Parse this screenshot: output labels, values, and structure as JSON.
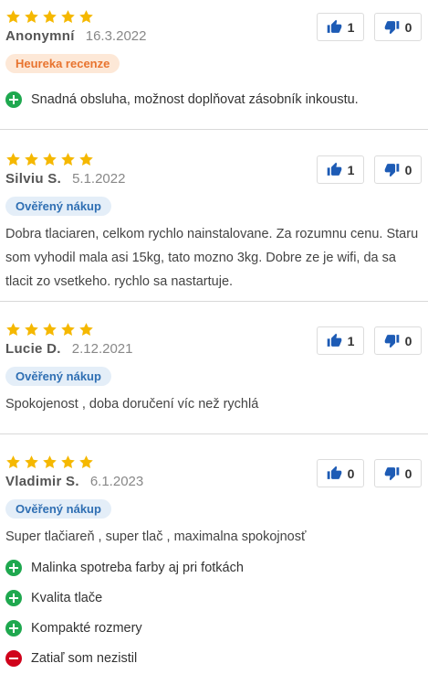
{
  "colors": {
    "star": "#f5b800",
    "accent": "#1d5bb5",
    "pro": "#1fa84f",
    "con": "#d0021b"
  },
  "reviews": [
    {
      "author": "Anonymní",
      "date": "16.3.2022",
      "badge": "Heureka recenze",
      "badge_type": "heureka",
      "rating": 5,
      "likes": "1",
      "dislikes": "0",
      "text": "",
      "points": [
        {
          "type": "pro",
          "text": "Snadná obsluha, možnost doplňovat zásobník inkoustu."
        }
      ]
    },
    {
      "author": "Silviu S.",
      "date": "5.1.2022",
      "badge": "Ověřený nákup",
      "badge_type": "verified",
      "rating": 5,
      "likes": "1",
      "dislikes": "0",
      "text": "Dobra tlaciaren, celkom rychlo nainstalovane. Za rozumnu cenu. Staru som vyhodil mala asi 15kg, tato mozno 3kg. Dobre ze je wifi, da sa tlacit zo vsetkeho. rychlo sa nastartuje.",
      "points": []
    },
    {
      "author": "Lucie D.",
      "date": "2.12.2021",
      "badge": "Ověřený nákup",
      "badge_type": "verified",
      "rating": 5,
      "likes": "1",
      "dislikes": "0",
      "text": "Spokojenost , doba doručení víc než rychlá",
      "points": []
    },
    {
      "author": "Vladimir S.",
      "date": "6.1.2023",
      "badge": "Ověřený nákup",
      "badge_type": "verified",
      "rating": 5,
      "likes": "0",
      "dislikes": "0",
      "text": "Super tlačiareň , super tlač , maximalna spokojnosť",
      "points": [
        {
          "type": "pro",
          "text": "Malinka spotreba farby aj pri fotkách"
        },
        {
          "type": "pro",
          "text": "Kvalita tlače"
        },
        {
          "type": "pro",
          "text": "Kompakté rozmery"
        },
        {
          "type": "con",
          "text": "Zatiaľ som nezistil"
        }
      ]
    }
  ]
}
